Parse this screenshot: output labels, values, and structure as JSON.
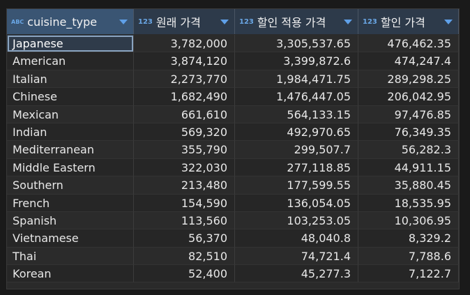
{
  "columns": [
    {
      "type": "ABC",
      "label": "cuisine_type"
    },
    {
      "type": "123",
      "label": "원래 가격"
    },
    {
      "type": "123",
      "label": "할인 적용 가격"
    },
    {
      "type": "123",
      "label": "할인 가격"
    }
  ],
  "rows": [
    [
      "Japanese",
      "3,782,000",
      "3,305,537.65",
      "476,462.35"
    ],
    [
      "American",
      "3,874,120",
      "3,399,872.6",
      "474,247.4"
    ],
    [
      "Italian",
      "2,273,770",
      "1,984,471.75",
      "289,298.25"
    ],
    [
      "Chinese",
      "1,682,490",
      "1,476,447.05",
      "206,042.95"
    ],
    [
      "Mexican",
      "661,610",
      "564,133.15",
      "97,476.85"
    ],
    [
      "Indian",
      "569,320",
      "492,970.65",
      "76,349.35"
    ],
    [
      "Mediterranean",
      "355,790",
      "299,507.7",
      "56,282.3"
    ],
    [
      "Middle Eastern",
      "322,030",
      "277,118.85",
      "44,911.15"
    ],
    [
      "Southern",
      "213,480",
      "177,599.55",
      "35,880.45"
    ],
    [
      "French",
      "154,590",
      "136,054.05",
      "18,535.95"
    ],
    [
      "Spanish",
      "113,560",
      "103,253.05",
      "10,306.95"
    ],
    [
      "Vietnamese",
      "56,370",
      "48,040.8",
      "8,329.2"
    ],
    [
      "Thai",
      "82,510",
      "74,721.4",
      "7,788.6"
    ],
    [
      "Korean",
      "52,400",
      "45,277.3",
      "7,122.7"
    ]
  ]
}
